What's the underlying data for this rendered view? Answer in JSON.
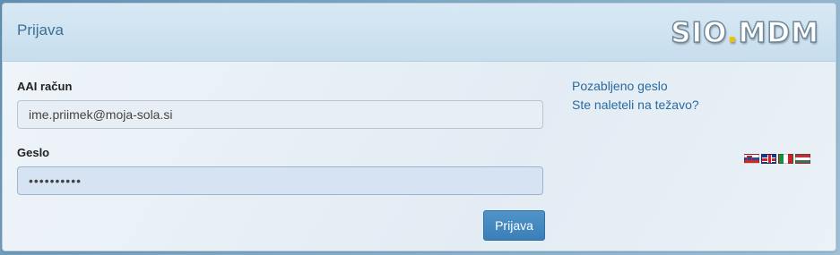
{
  "header": {
    "title": "Prijava",
    "logo_text_1": "SIO",
    "logo_dot": ".",
    "logo_text_2": "MDM"
  },
  "form": {
    "username_label": "AAI račun",
    "username_value": "ime.priimek@moja-sola.si",
    "password_label": "Geslo",
    "password_value": "••••••••••",
    "submit_label": "Prijava"
  },
  "help_links": {
    "forgot_password": "Pozabljeno geslo",
    "having_trouble": "Ste naleteli na težavo?"
  },
  "languages": [
    "slovenian-flag-icon",
    "english-flag-icon",
    "italian-flag-icon",
    "hungarian-flag-icon"
  ]
}
